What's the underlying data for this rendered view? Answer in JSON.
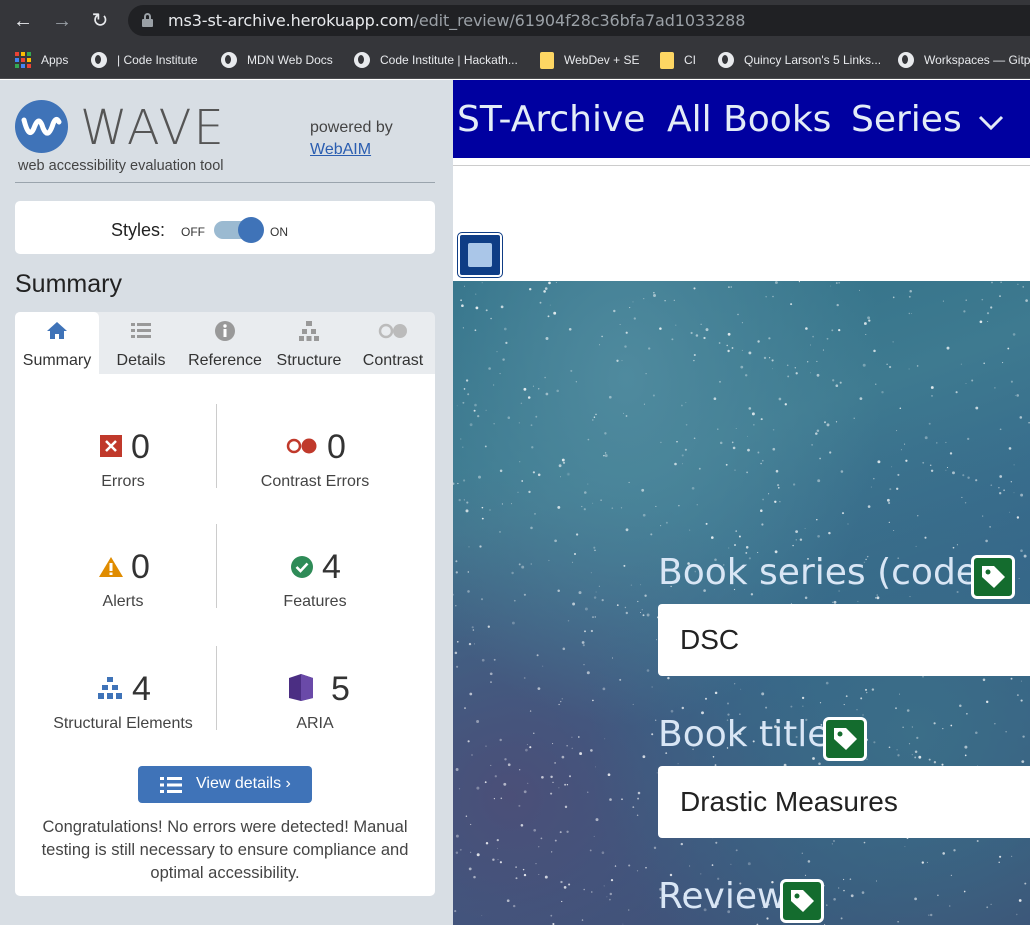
{
  "browser": {
    "url_host": "ms3-st-archive.herokuapp.com",
    "url_path": "/edit_review/61904f28c36bfa7ad1033288",
    "bookmarks": [
      {
        "label": "Apps",
        "icon": "apps-grid-icon"
      },
      {
        "label": "| Code Institute",
        "icon": "globe-icon"
      },
      {
        "label": "MDN Web Docs",
        "icon": "globe-icon"
      },
      {
        "label": "Code Institute | Hackath...",
        "icon": "globe-icon"
      },
      {
        "label": "WebDev + SE",
        "icon": "folder-icon"
      },
      {
        "label": "CI",
        "icon": "folder-icon"
      },
      {
        "label": "Quincy Larson's 5 Links...",
        "icon": "globe-icon"
      },
      {
        "label": "Workspaces — Gitpo",
        "icon": "globe-icon"
      }
    ]
  },
  "wave": {
    "title": "WAVE",
    "subtitle": "web accessibility evaluation tool",
    "powered_by": "powered by",
    "webaim": "WebAIM",
    "styles_label": "Styles:",
    "styles_off": "OFF",
    "styles_on": "ON",
    "summary_heading": "Summary",
    "tabs": [
      {
        "label": "Summary",
        "icon": "home-icon"
      },
      {
        "label": "Details",
        "icon": "list-icon"
      },
      {
        "label": "Reference",
        "icon": "info-icon"
      },
      {
        "label": "Structure",
        "icon": "structure-icon"
      },
      {
        "label": "Contrast",
        "icon": "contrast-icon"
      }
    ],
    "stats": {
      "errors": {
        "count": "0",
        "label": "Errors"
      },
      "contrast_errors": {
        "count": "0",
        "label": "Contrast Errors"
      },
      "alerts": {
        "count": "0",
        "label": "Alerts"
      },
      "features": {
        "count": "4",
        "label": "Features"
      },
      "structural": {
        "count": "4",
        "label": "Structural Elements"
      },
      "aria": {
        "count": "5",
        "label": "ARIA"
      }
    },
    "view_details": "View details ›",
    "congrats": "Congratulations! No errors were detected! Manual testing is still necessary to ensure compliance and optimal accessibility."
  },
  "site": {
    "brand": "ST-Archive",
    "nav_all_books": "All Books",
    "nav_series": "Series",
    "fields": [
      {
        "label": "Book series (code)",
        "value": "DSC"
      },
      {
        "label": "Book title",
        "value": "Drastic Measures"
      },
      {
        "label": "Review",
        "value": ""
      }
    ]
  },
  "colors": {
    "wave_blue": "#3f73b8",
    "nav_blue": "#0000a0",
    "error_red": "#c0392b",
    "feature_green": "#2e8b57",
    "alert_orange": "#e08c00",
    "aria_purple": "#4b2e83",
    "tag_green": "#146c2e"
  }
}
